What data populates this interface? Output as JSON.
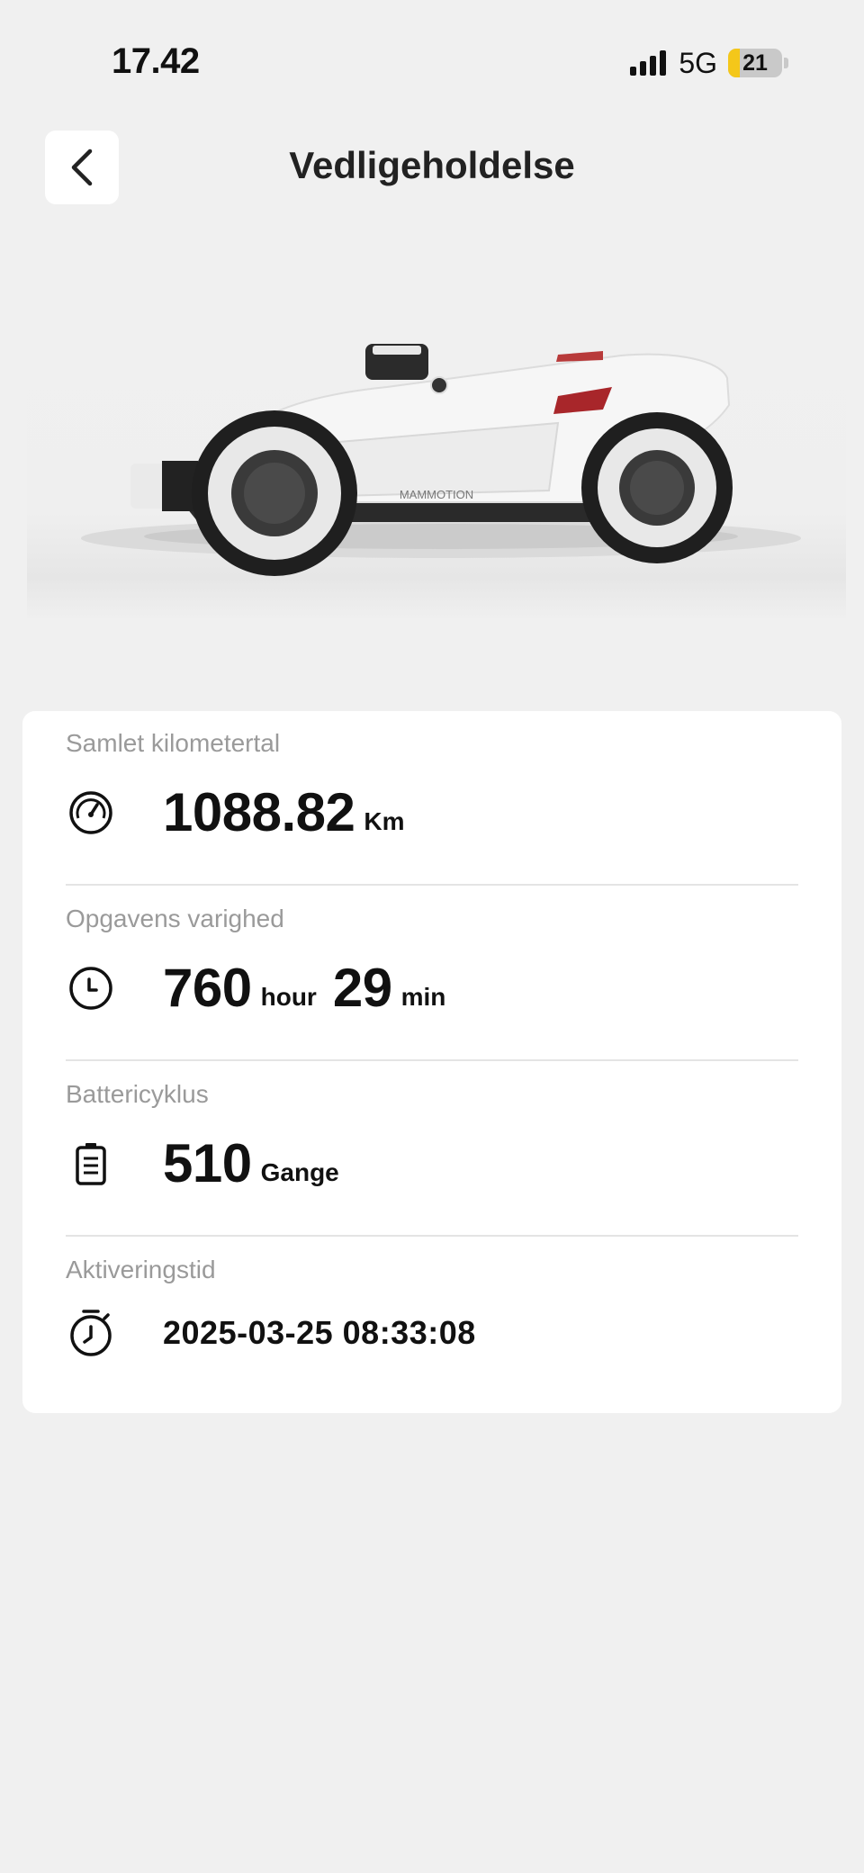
{
  "status_bar": {
    "time": "17.42",
    "network": "5G",
    "battery_percent": "21",
    "battery_level": 0.21
  },
  "header": {
    "title": "Vedligeholdelse",
    "back_icon": "chevron-left-icon"
  },
  "hero": {
    "brand_text": "MAMMOTION"
  },
  "stats": {
    "mileage": {
      "label": "Samlet kilometertal",
      "value": "1088.82",
      "unit": "Km",
      "icon": "speedometer-icon"
    },
    "duration": {
      "label": "Opgavens varighed",
      "hours": "760",
      "hours_unit": "hour",
      "minutes": "29",
      "minutes_unit": "min",
      "icon": "clock-icon"
    },
    "battery_cycles": {
      "label": "Battericyklus",
      "value": "510",
      "unit": "Gange",
      "icon": "battery-icon"
    },
    "activation": {
      "label": "Aktiveringstid",
      "value": "2025-03-25 08:33:08",
      "icon": "stopwatch-icon"
    }
  }
}
